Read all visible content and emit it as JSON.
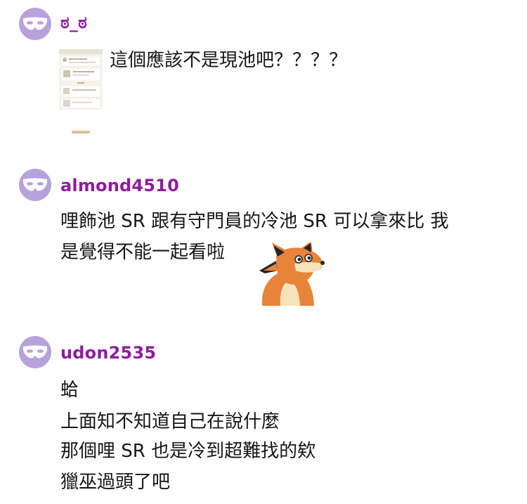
{
  "comments": [
    {
      "username": "ಠ_ಠ",
      "lines": [
        "這個應該不是現池吧？？？？"
      ]
    },
    {
      "username": "almond4510",
      "lines": [
        "哩飾池 SR 跟有守門員的冷池 SR 可以拿來比 我",
        "是覺得不能一起看啦"
      ]
    },
    {
      "username": "udon2535",
      "lines": [
        "蛤",
        "上面知不知道自己在說什麼",
        "那個哩 SR 也是冷到超難找的欸",
        "獵巫過頭了吧"
      ]
    }
  ],
  "icons": {
    "avatar": "anonymous-mask-icon",
    "fox_sticker": "fox-sticker",
    "thumbnail": "screenshot-thumbnail"
  },
  "colors": {
    "avatar_bg": "#b7a2dc",
    "username": "#8e1d9e",
    "text": "#161616"
  }
}
